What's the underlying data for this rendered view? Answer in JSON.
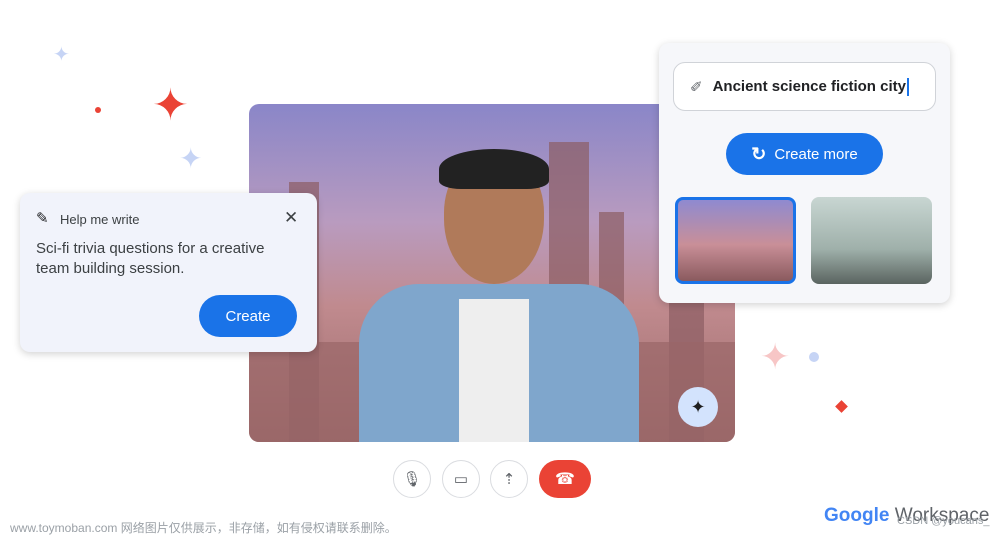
{
  "help_me_write": {
    "title": "Help me write",
    "prompt": "Sci-fi trivia questions for a creative team building session.",
    "create_label": "Create",
    "icons": [
      "pencil-sparkle-icon",
      "close-icon"
    ]
  },
  "image_gen": {
    "prompt_value": "Ancient science fiction city",
    "create_more_label": "Create more",
    "icons": [
      "brush-sparkle-icon",
      "refresh-icon"
    ],
    "selected_thumbnail": 0
  },
  "call_controls": {
    "icons": [
      "microphone-icon",
      "camera-icon",
      "present-screen-icon",
      "end-call-icon"
    ],
    "end_call_color": "#ea4335"
  },
  "brand": {
    "google": "Google",
    "workspace": "Workspace"
  },
  "watermarks": {
    "left": "www.toymoban.com 网络图片仅供展示，非存储，如有侵权请联系删除。",
    "right": "CSDN @youcans_"
  },
  "colors": {
    "accent": "#1a73e8",
    "red": "#ea4335"
  }
}
